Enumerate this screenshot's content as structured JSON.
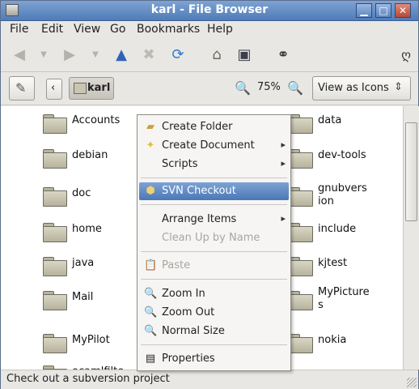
{
  "window": {
    "title": "karl - File Browser",
    "min": "▁",
    "max": "□",
    "close": "✕"
  },
  "menubar": [
    "File",
    "Edit",
    "View",
    "Go",
    "Bookmarks",
    "Help"
  ],
  "toolbar": {
    "icons": [
      "back-arrow-icon",
      "back-dropdown-icon",
      "forward-arrow-icon",
      "forward-dropdown-icon",
      "up-arrow-icon",
      "stop-icon",
      "reload-icon",
      "home-icon",
      "computer-icon",
      "search-binoculars-icon",
      "gnome-foot-icon"
    ]
  },
  "location": {
    "folder": "karl",
    "zoom": "75%",
    "view_mode": "View as Icons"
  },
  "files": [
    [
      "Accounts",
      "",
      "data"
    ],
    [
      "debian",
      "",
      "dev-tools"
    ],
    [
      "doc",
      "",
      "gnubversion"
    ],
    [
      "home",
      "",
      "include"
    ],
    [
      "java",
      "",
      "kjtest"
    ],
    [
      "Mail",
      "",
      "MyPictures"
    ],
    [
      "MyPilot",
      "",
      "nokia"
    ],
    [
      "ocamlfilte",
      "",
      ""
    ]
  ],
  "context_menu": [
    {
      "label": "Create Folder",
      "icon": "new-folder-icon",
      "submenu": false,
      "state": "normal"
    },
    {
      "label": "Create Document",
      "icon": "new-document-icon",
      "submenu": true,
      "state": "normal"
    },
    {
      "label": "Scripts",
      "icon": "",
      "submenu": true,
      "state": "normal"
    },
    {
      "label": "SVN Checkout",
      "icon": "svn-icon",
      "submenu": false,
      "state": "selected"
    },
    {
      "label": "Arrange Items",
      "icon": "",
      "submenu": true,
      "state": "normal"
    },
    {
      "label": "Clean Up by Name",
      "icon": "",
      "submenu": false,
      "state": "disabled"
    },
    {
      "label": "Paste",
      "icon": "paste-icon",
      "submenu": false,
      "state": "disabled"
    },
    {
      "label": "Zoom In",
      "icon": "zoom-in-icon",
      "submenu": false,
      "state": "normal"
    },
    {
      "label": "Zoom Out",
      "icon": "zoom-out-icon",
      "submenu": false,
      "state": "normal"
    },
    {
      "label": "Normal Size",
      "icon": "zoom-normal-icon",
      "submenu": false,
      "state": "normal"
    },
    {
      "label": "Properties",
      "icon": "properties-icon",
      "submenu": false,
      "state": "normal"
    }
  ],
  "status": "Check out a subversion project"
}
